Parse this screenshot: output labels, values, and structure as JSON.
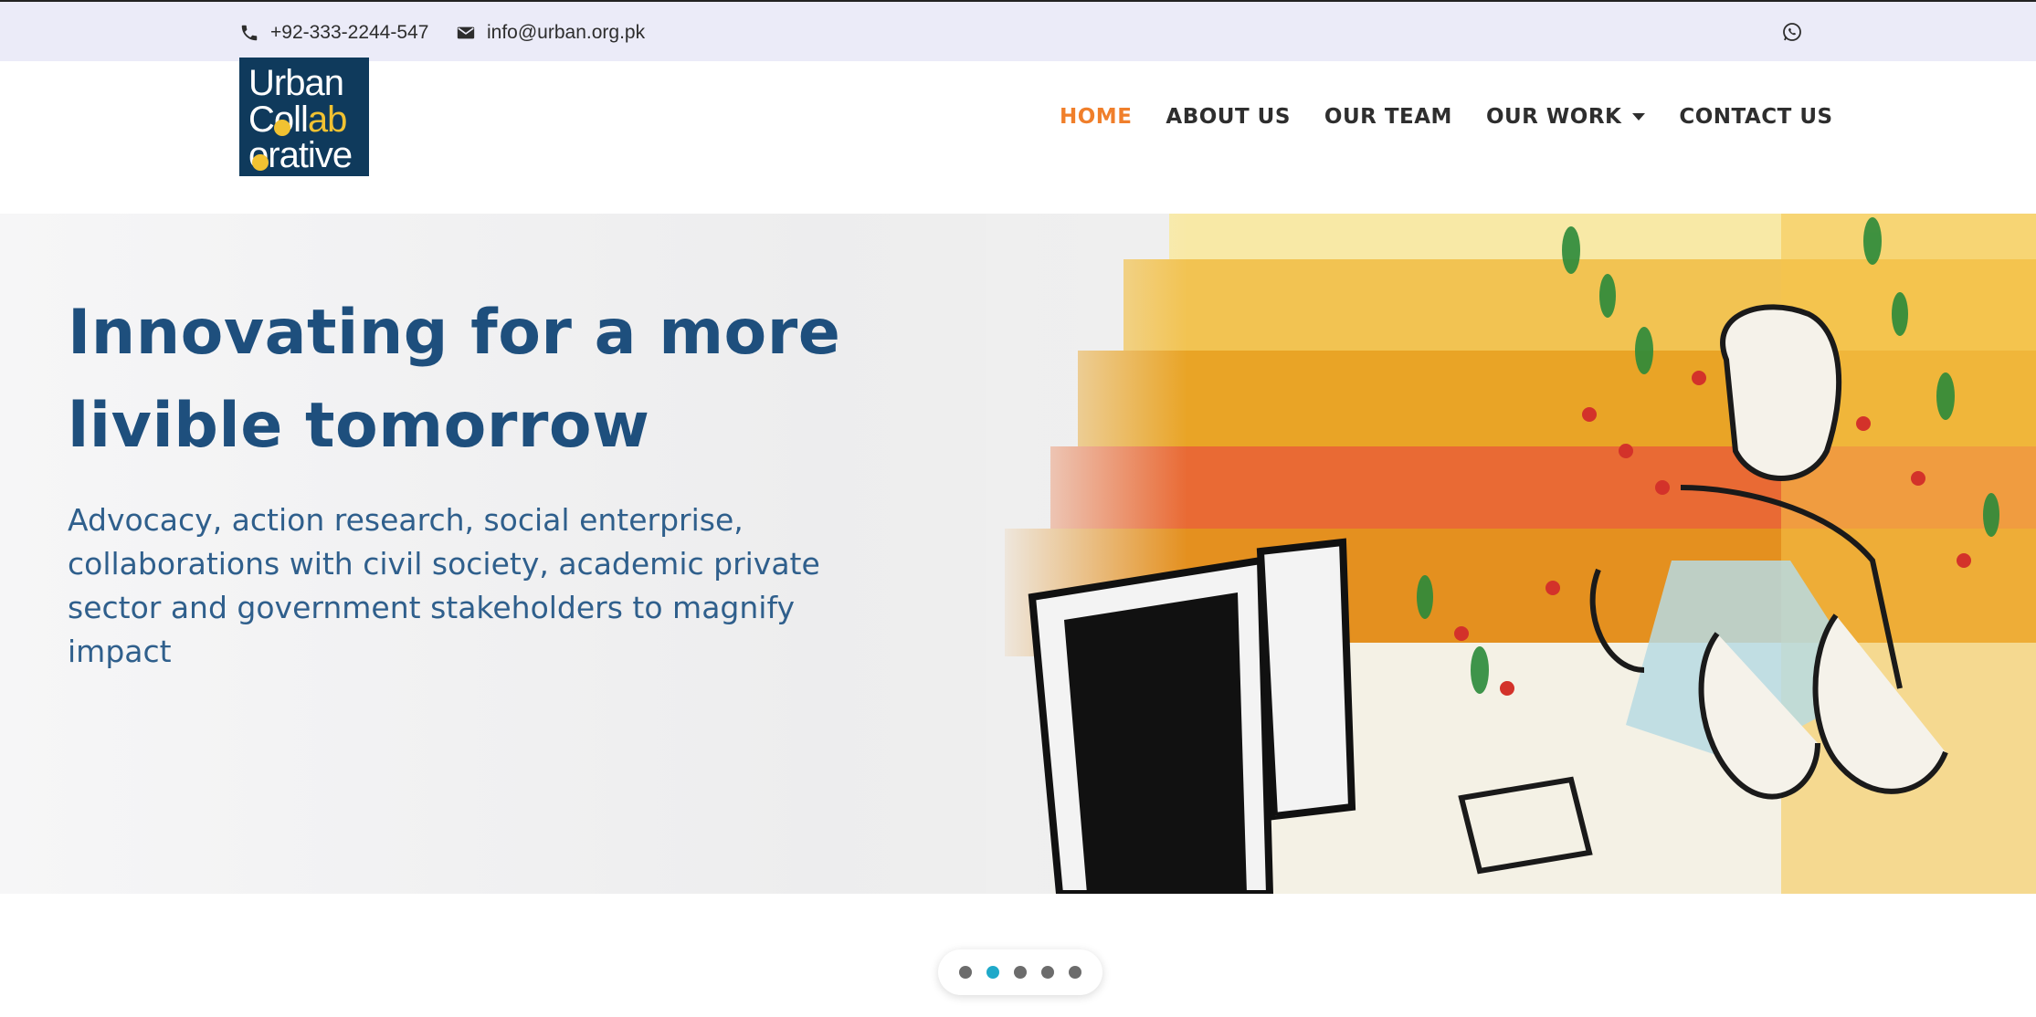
{
  "topbar": {
    "phone": "+92-333-2244-547",
    "email": "info@urban.org.pk",
    "icons": [
      "phone-icon",
      "envelope-icon",
      "whatsapp-icon"
    ]
  },
  "logo": {
    "line1": "Urban",
    "line2": "Collab",
    "line3": "orative",
    "bg_color": "#0f3a5c",
    "accent_color": "#f1c232"
  },
  "nav": {
    "items": [
      {
        "label": "HOME",
        "active": true
      },
      {
        "label": "ABOUT US",
        "active": false
      },
      {
        "label": "OUR TEAM",
        "active": false
      },
      {
        "label": "OUR WORK",
        "active": false,
        "dropdown": true
      },
      {
        "label": "CONTACT US",
        "active": false
      }
    ],
    "active_color": "#f07f2b"
  },
  "hero": {
    "title": "Innovating for a more livible tomorrow",
    "subtitle": "Advocacy, action research, social enterprise, collaborations with civil society, academic private sector and government stakeholders to magnify impact",
    "title_color": "#1e4f7d"
  },
  "slider": {
    "slide_count": 5,
    "active_index": 1,
    "active_color": "#1fa9c9"
  }
}
